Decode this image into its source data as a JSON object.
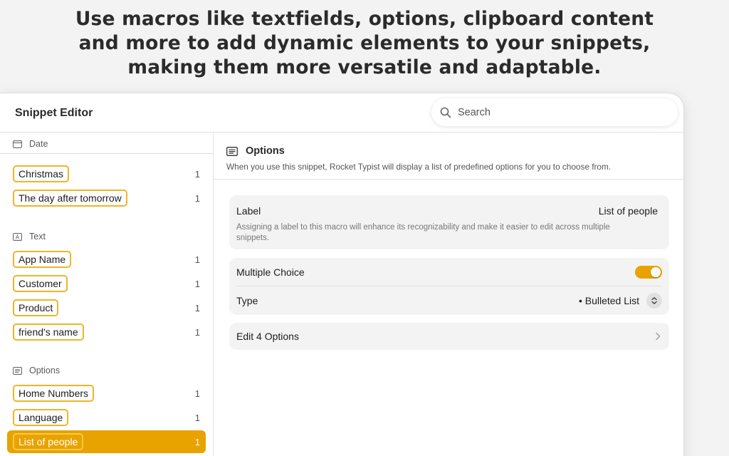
{
  "headline": {
    "line1": "Use macros like textfields, options, clipboard content",
    "line2": "and more to add dynamic elements to your snippets,",
    "line3": "making them more versatile and adaptable."
  },
  "window": {
    "title": "Snippet Editor",
    "search": {
      "placeholder": "Search",
      "icon": "search-icon"
    }
  },
  "sidebar": {
    "sections": [
      {
        "header": "Date",
        "icon": "calendar-icon",
        "items": [
          {
            "label": "Christmas",
            "count": "1"
          },
          {
            "label": "The day after tomorrow",
            "count": "1"
          }
        ]
      },
      {
        "header": "Text",
        "icon": "text-field-icon",
        "items": [
          {
            "label": "App Name",
            "count": "1"
          },
          {
            "label": "Customer",
            "count": "1"
          },
          {
            "label": "Product",
            "count": "1"
          },
          {
            "label": "friend's name",
            "count": "1"
          }
        ]
      },
      {
        "header": "Options",
        "icon": "list-icon",
        "items": [
          {
            "label": "Home Numbers",
            "count": "1"
          },
          {
            "label": "Language",
            "count": "1"
          },
          {
            "label": "List of people",
            "count": "1",
            "selected": true
          }
        ]
      }
    ]
  },
  "main": {
    "title": "Options",
    "icon": "list-icon",
    "description": "When you use this snippet, Rocket Typist will display a list of predefined options for you to choose from.",
    "label_card": {
      "key": "Label",
      "value": "List of people",
      "help": "Assigning a label to this macro will enhance its recognizability and make it easier to edit across multiple snippets."
    },
    "options_card": {
      "multiple_choice_label": "Multiple Choice",
      "multiple_choice_on": true,
      "type_label": "Type",
      "type_value": "• Bulleted List"
    },
    "edit_label": "Edit 4 Options"
  },
  "colors": {
    "accent": "#e8a300",
    "tag_border": "#f0b429"
  }
}
